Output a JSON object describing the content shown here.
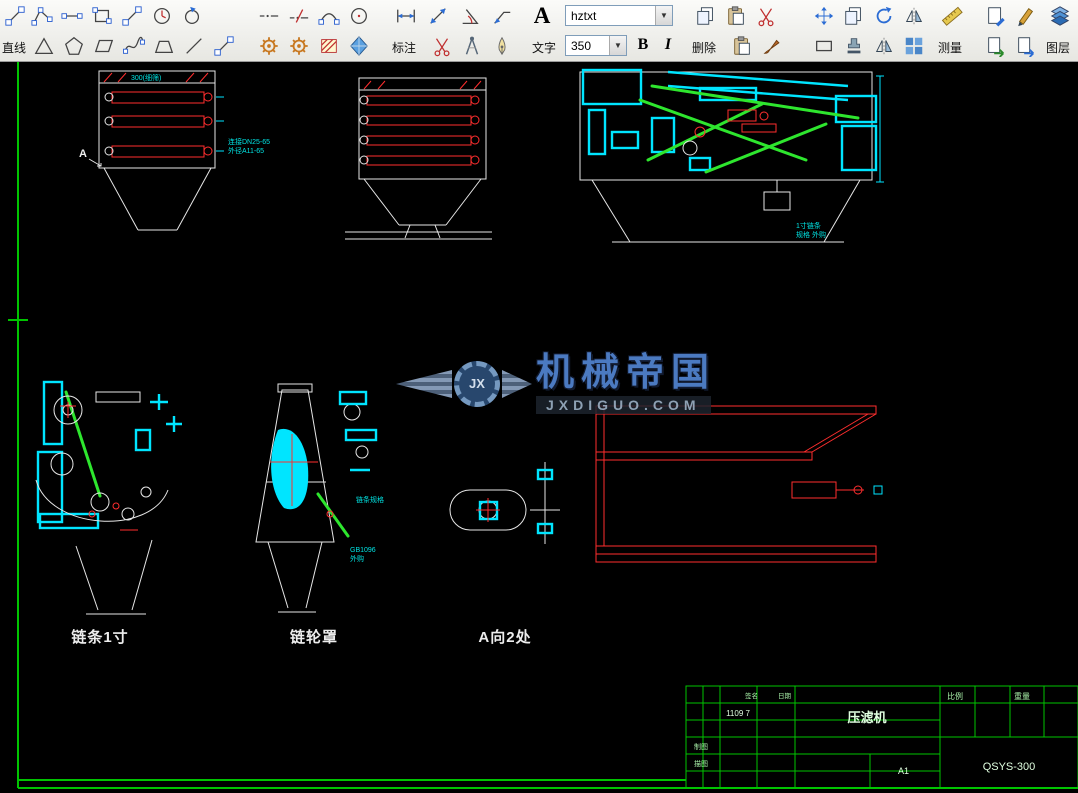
{
  "toolbar": {
    "labels": {
      "line": "直线",
      "dimension": "标注",
      "text": "文字",
      "erase": "删除",
      "measure": "测量",
      "layer": "图层"
    },
    "text_tool": {
      "letter": "A",
      "style": "hztxt",
      "size": "350",
      "bold": "B",
      "italic": "I"
    }
  },
  "canvas": {
    "marker_a": "A",
    "view_labels": {
      "chain": "链条1寸",
      "cover": "链轮罩",
      "a_view": "A向2处"
    },
    "notes": {
      "front_band": "300(细筛)",
      "front_1": "连接DN25-65",
      "front_2": "外径A11-65",
      "rear_1": "1寸链条",
      "rear_2": "规格 外购",
      "cover_1": "链条规格",
      "cover_2": "GB1096",
      "cover_3": "外购"
    },
    "watermark": {
      "gear": "JX",
      "title": "机械帝国",
      "url": "JXDIGUO.COM"
    }
  },
  "title_block": {
    "part_name": "压滤机",
    "drawing_no": "QSYS-300",
    "scale_label": "比例",
    "weight_label": "重量",
    "sign_label": "签名",
    "date_label": "日期",
    "date_value": "1109 7",
    "draft_label": "制图",
    "trace_label": "描图",
    "paper_size": "A1"
  }
}
